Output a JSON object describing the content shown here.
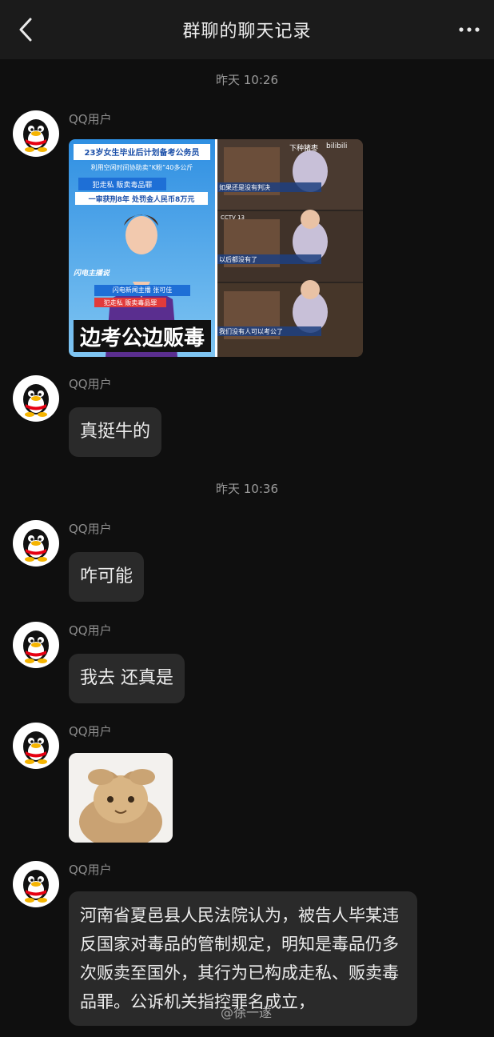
{
  "header": {
    "title": "群聊的聊天记录",
    "back_icon": "back-arrow-icon",
    "more_icon": "more-dots-icon"
  },
  "timestamps": [
    "昨天 10:26",
    "昨天 10:36"
  ],
  "messages": [
    {
      "user": "QQ用户",
      "type": "image",
      "image": {
        "left": {
          "headline": "23岁女生毕业后计划备考公务员",
          "subhead": "利用空闲时间协助卖“K粉”40多公斤",
          "charge1": "犯走私 贩卖毒品罪",
          "sentence": "一审获刑8年 处罚金人民币8万元",
          "anchor_tag": "闪电新闻主播 张可佳",
          "charge2": "犯走私 贩卖毒品罪",
          "caption": "边考公边贩毒",
          "logo": "闪电主播说"
        },
        "right": {
          "top_label": "下种猪枣",
          "platform": "bilibili",
          "sub1": "如果还是没有判决",
          "sub2": "以后都没有了",
          "sub3": "我们没有人可以考公了",
          "channel": "CCTV 13"
        }
      }
    },
    {
      "user": "QQ用户",
      "type": "text",
      "text": "真挺牛的"
    },
    {
      "user": "QQ用户",
      "type": "text",
      "text": "咋可能"
    },
    {
      "user": "QQ用户",
      "type": "text",
      "text": "我去 还真是"
    },
    {
      "user": "QQ用户",
      "type": "sticker",
      "sticker": "cat-holding-head-sticker"
    },
    {
      "user": "QQ用户",
      "type": "text",
      "text": "河南省夏邑县人民法院认为，被告人毕某违反国家对毒品的管制规定，明知是毒品仍多次贩卖至国外，其行为已构成走私、贩卖毒品罪。公诉机关指控罪名成立，"
    }
  ],
  "watermark": "@徐一遂",
  "colors": {
    "background": "#0f0f0f",
    "header": "#1b1b1b",
    "bubble": "#2a2a2a",
    "purple_news": "#5a2e8f",
    "news_blue": "#1f78c8"
  }
}
